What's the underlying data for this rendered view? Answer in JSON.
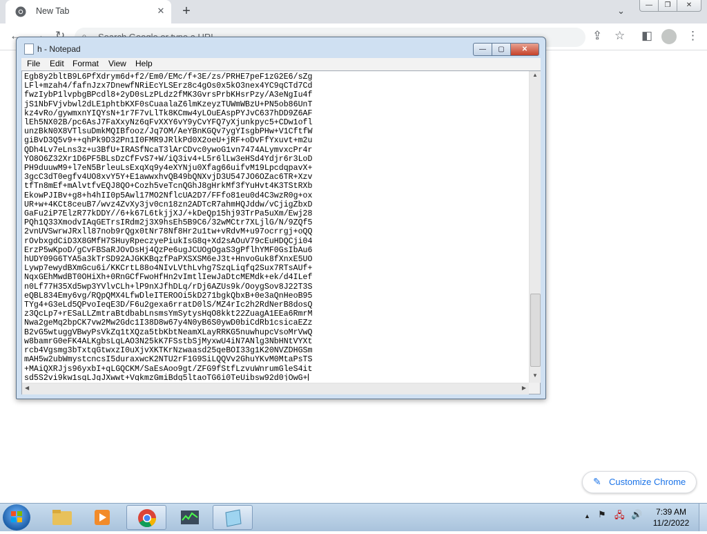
{
  "browser": {
    "tab_title": "New Tab",
    "tab_close_glyph": "✕",
    "new_tab_glyph": "+",
    "tab_dropdown_glyph": "⌄",
    "omnibox_placeholder": "Search Google or type a URL",
    "window_controls": {
      "min": "—",
      "max": "❐",
      "close": "✕"
    }
  },
  "notepad": {
    "title": "h - Notepad",
    "menu": [
      "File",
      "Edit",
      "Format",
      "View",
      "Help"
    ],
    "controls": {
      "min": "—",
      "max": "▢",
      "close": "✕"
    },
    "lines": [
      "Egb8y2bltB9L6PfXdrym6d+f2/Em0/EMc/f+3E/zs/PRHE7peF1zG2E6/sZg",
      "LFl+mzah4/fafnJzx7DnewfNRiEcYLSErz8c4gOs0x5kO3nex4YC9qCTd7Cd",
      "fwzIybP1lvpbgBPcdl8+2yD0sLzPLdz2fMK3GvrsPrbKHsrPzy/A3eNgIu4f",
      "jS1NbFVjvbwl2dLE1phtbKXF0sCuaalaZ6lmKzeyzTUWmWBzU+PN5ob86UnT",
      "kz4vRo/gywmxnYIQYsN+1r7F7vLlTk8KCmw4yLOuEAspPYJvC637hDD9Z6AF",
      "lEh5NX02B/pc6AsJ7FaXxyNz6qFvXXY6vY9yCvYFQ7yXjunkpyc5+CDw1ofl",
      "unzBkN0X8VTlsuDmkMQIBfooz/Jq7OM/AeYBnKGQv7ygYIsgbPHw+V1CftfW",
      "giBvD3Q5v9++qhPk9D32Pn1I0FMR9JRlkPd0X2oeU+jRF+oDvFfYxuvt+m2u",
      "QDh4Lv7eLns3z+u3BfU+IRASfNcaT3lArCDvc0ywoG1vn7474ALymvxcPr4r",
      "YO8O6Z32Xr1D6PF5BLsDzCfFvS7+W/iQ3iv4+L5r6lLw3eHSd4Ydjr6r3LoD",
      "PH9duuwM9+l7eN5BrleuLsExqXq9y4eXYNju0Xfag66uifvM19LpcdqpavX+",
      "3gcC3dT0egfv4UO8xvY5Y+E1awwxhvQB49bQNXvjD3U547JO6OZac6TR+Xzv",
      "tfTn8mEf+mAlvtfvEQJ8QO+Cozh5veTcnQGhJ8gHrkMf3fYuHvt4K3TStRXb",
      "EkowPJIBv+g8+h4hII0p5Awl17MO2NflcUA2D7/FFfo81eu0d4C3wzR0g+ox",
      "UR+w+4KCt8ceuB7/wvz4ZvXy3jv0cn18zn2ADTcR7ahmHQJddw/vCjigZbxD",
      "GaFu2iP7ElzR77kDDY//6+k67L6tkjjXJ/+kDeQp15hj93TrPa5uXm/Ewj28",
      "PQh1Q33XmodvIAqGETrsIRdm2j3X9hsEh5B9C6/32wMCtr7XLjlG/N/9ZQf5",
      "2vnUVSwrwJRxll87nob9rQgx0tNr78Nf8Hr2u1tw+vRdvM+u97ocrrgj+oQQ",
      "rOvbxgdCiD3X8GMfH7SHuyRpeczyePiukIsG8q+Xd2sAOuV79cEuHDQCji04",
      "ErzP5wKpoD/gCvFBSaRJOvDsHj4QzPe6ugJCUOgOgaS3gPflhYMF0GsIbAu6",
      "hUDY09G6TYA5a3kTrSD92AJGKKBqzfPaPXSXSM6eJ3t+HnvoGuk8fXnxE5UO",
      "Lywp7ewydBXmGcu6i/KKCrtL88o4NIvLVthLvhg7SzqLiqfq2Sux7RTsAUf+",
      "NqxGEhMwdBT0OHiXh+0RnGCfFwoHfHn2vImtlIewJaDtcMEMdk+ek/d4ILef",
      "n0Lf77H35Xd5wp3YVlvCLh+lP9nXJfhDLq/rDj6AZUs9k/OoygSov8J22T3S",
      "eQBL834Emy6vg/RQpQMX4LfwDleITEROOi5kD271bgkQbxB+0e3aQnHeoB95",
      "TYg4+G3eLd5QPvoIeqE3D/F6u2gexa6rratD0lS/MZ4rIc2h2RdNerB8dosQ",
      "z3QcLp7+rESaLLZmtraBtdbabLnsmsYmSytysHqO8kkt22ZuagA1EEa6RmrM",
      "Nwa2geMq2bpCK7vw2Mw2Gdc1I38D8w67y4N0yB6S0ywD0biCdRb1csicaEZz",
      "B2vG5wtuggVBwyPsVkZq1tXQza5tbKbtNeamXLayRRKG5nuwhupcVsoMrVwQ",
      "w8bamrG0eFK4ALKgbsLqLAO3N25kK7FSstbSjMyxwU4iN7ANlg3NbHNtVYXt",
      "rcb4Vgsmg3bTxtqGtwxzI0uXjvXKTKrNzwaasd25qeBOI33g1K20NVZDHGSm",
      "mAH5w2ubWmystcncsI5duraxwcK2NTU2rF1G9SiLQQVv2GhuYKvM0MtaPsTS",
      "+MAiQXRJjs96yxbI+qLGQCKM/SaEsAoo9gt/ZFG9fStfLzvuWnrumGleS4it",
      "sd5S2vi9kw1sqLJgJXwwt+VqkmzGmiBdg5ltaoTG6i0TeUibsw92d0jOwG+"
    ]
  },
  "customize": {
    "label": "Customize Chrome",
    "icon": "pencil-icon"
  },
  "taskbar": {
    "apps": [
      "explorer",
      "media-player",
      "chrome",
      "task-manager",
      "notepad"
    ],
    "time": "7:39 AM",
    "date": "11/2/2022",
    "tray_up_glyph": "▲"
  }
}
